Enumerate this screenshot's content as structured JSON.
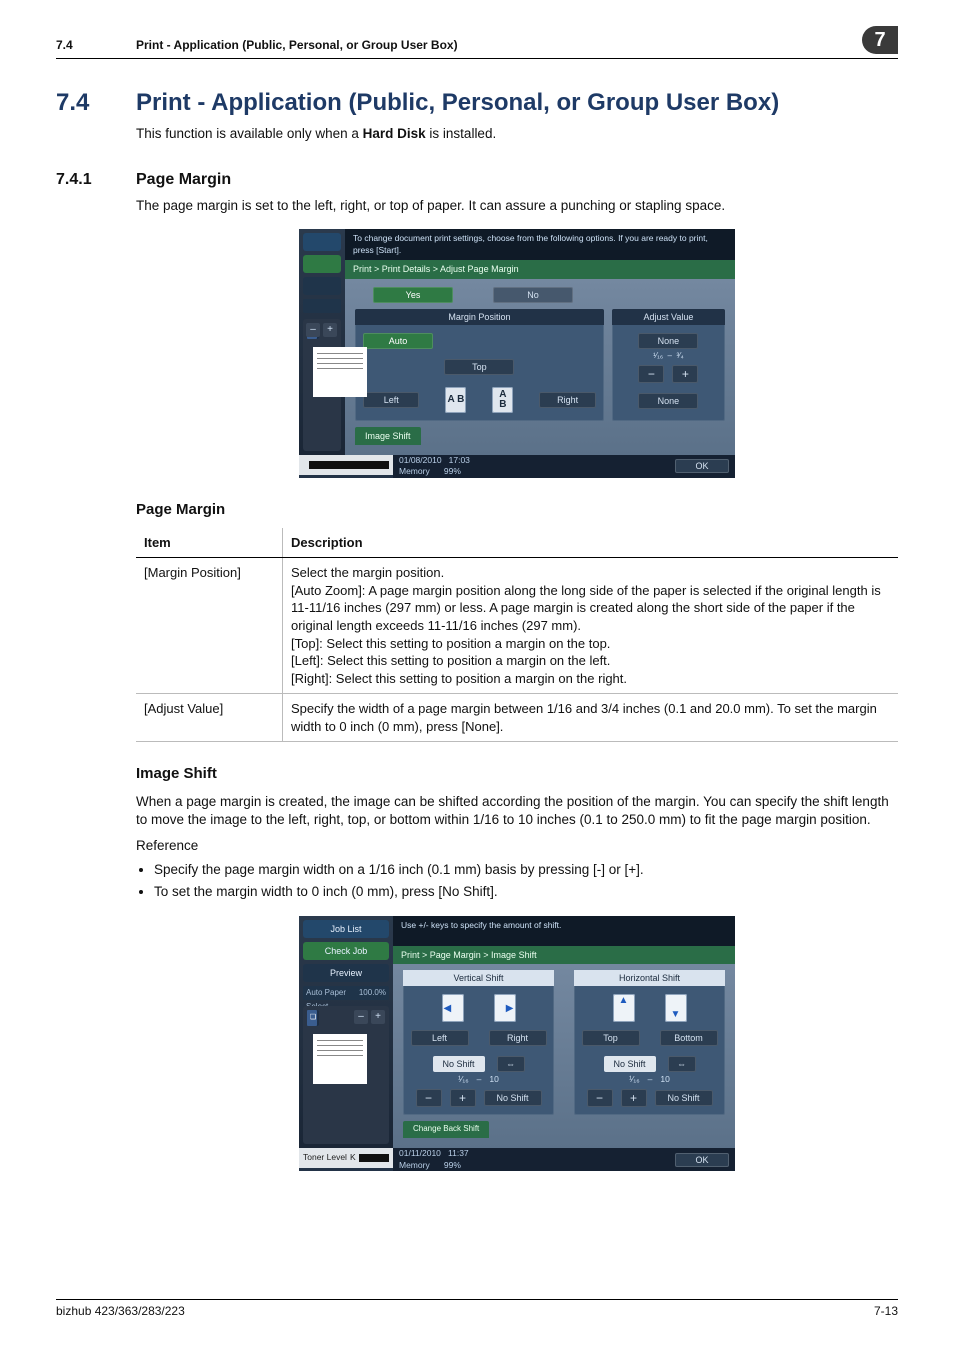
{
  "header": {
    "sec": "7.4",
    "title": "Print - Application (Public, Personal, or Group User Box)",
    "badge": "7"
  },
  "h1": {
    "num": "7.4",
    "title": "Print - Application (Public, Personal, or Group User Box)"
  },
  "intro": {
    "pre": "This function is available only when a ",
    "bold": "Hard Disk",
    "post": " is installed."
  },
  "h2_1": {
    "num": "7.4.1",
    "title": "Page Margin"
  },
  "p1": "The page margin is set to the left, right, or top of paper. It can assure a punching or stapling space.",
  "ss1": {
    "left": "Left",
    "topmsg": "To change document print settings, choose from the following options. If you are ready to print, press [Start].",
    "breadcrumb": "Print > Print Details > Adjust Page Margin",
    "yes": "Yes",
    "no": "No",
    "mp_hd": "Margin Position",
    "av_hd": "Adjust Value",
    "auto": "Auto",
    "top": "Top",
    "right": "Right",
    "none1": "None",
    "fracL": "¹⁄₁₆",
    "dash": "–",
    "fracR": "³⁄₄",
    "none2": "None",
    "image_shift_tab": "Image Shift",
    "date": "01/08/2010",
    "time": "17:03",
    "mem": "Memory",
    "memv": "99%",
    "ok": "OK"
  },
  "h3_1": "Page Margin",
  "table": {
    "hd_item": "Item",
    "hd_desc": "Description",
    "r1_item": "[Margin Position]",
    "r1_desc": "Select the margin position.\n[Auto Zoom]: A page margin position along the long side of the paper is selected if the original length is 11-11/16 inches (297 mm) or less. A page margin is created along the short side of the paper if the original length exceeds 11-11/16 inches (297 mm).\n[Top]: Select this setting to position a margin on the top.\n[Left]: Select this setting to position a margin on the left.\n[Right]: Select this setting to position a margin on the right.",
    "r2_item": "[Adjust Value]",
    "r2_desc": "Specify the width of a page margin between 1/16 and 3/4 inches (0.1 and 20.0 mm). To set the margin width to 0 inch (0 mm), press [None]."
  },
  "h3_2": "Image Shift",
  "p2": "When a page margin is created, the image can be shifted according the position of the margin. You can specify the shift length to move the image to the left, right, top, or bottom within 1/16 to 10 inches (0.1 to 250.0 mm) to fit the page margin position.",
  "ref_label": "Reference",
  "ref1": "Specify the page margin width on a 1/16 inch (0.1 mm) basis by pressing [-] or [+].",
  "ref2": "To set the margin width to 0 inch (0 mm), press [No Shift].",
  "ss2": {
    "left": {
      "job_list": "Job List",
      "check_job": "Check Job",
      "preview": "Preview",
      "autopaper": "Auto Paper Select",
      "zoom": "100.0%",
      "toner": "Toner Level",
      "k": "K"
    },
    "topmsg": "Use +/- keys to specify the amount of shift.",
    "breadcrumb": "Print > Page Margin > Image Shift",
    "v_hd": "Vertical Shift",
    "h_hd": "Horizontal Shift",
    "v_a": "Left",
    "v_b": "Right",
    "h_a": "Top",
    "h_b": "Bottom",
    "noshift": "No Shift",
    "swap": "⇔",
    "unit": "¹⁄₁₆",
    "dash": "–",
    "max": "10",
    "change_back": "Change Back Shift",
    "date": "01/11/2010",
    "time": "11:37",
    "mem": "Memory",
    "memv": "99%",
    "ok": "OK"
  },
  "footer": {
    "model": "bizhub 423/363/283/223",
    "page": "7-13"
  }
}
